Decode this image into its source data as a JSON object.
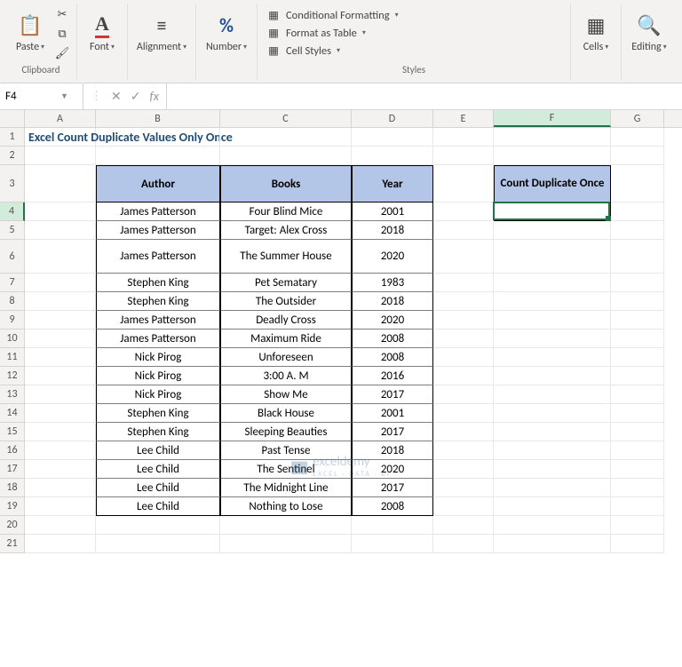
{
  "ribbon": {
    "clipboard": {
      "label": "Clipboard",
      "paste": "Paste"
    },
    "font": {
      "label": "Font"
    },
    "alignment": {
      "label": "Alignment"
    },
    "number": {
      "label": "Number"
    },
    "styles": {
      "label": "Styles",
      "conditional": "Conditional Formatting",
      "table": "Format as Table",
      "cellstyles": "Cell Styles"
    },
    "cells": {
      "label": "Cells"
    },
    "editing": {
      "label": "Editing"
    }
  },
  "formula_bar": {
    "name_box": "F4",
    "fx": "fx",
    "formula": ""
  },
  "columns": [
    "A",
    "B",
    "C",
    "D",
    "E",
    "F",
    "G"
  ],
  "active_cell": "F4",
  "title": "Excel Count Duplicate Values Only Once",
  "table": {
    "headers": {
      "author": "Author",
      "books": "Books",
      "year": "Year"
    },
    "rows": [
      {
        "author": "James Patterson",
        "book": "Four Blind Mice",
        "year": "2001"
      },
      {
        "author": "James Patterson",
        "book": "Target: Alex Cross",
        "year": "2018"
      },
      {
        "author": "James Patterson",
        "book": "The Summer House",
        "year": "2020"
      },
      {
        "author": "Stephen King",
        "book": "Pet Sematary",
        "year": "1983"
      },
      {
        "author": "Stephen King",
        "book": "The Outsider",
        "year": "2018"
      },
      {
        "author": "James Patterson",
        "book": "Deadly Cross",
        "year": "2020"
      },
      {
        "author": "James Patterson",
        "book": "Maximum Ride",
        "year": "2008"
      },
      {
        "author": "Nick Pirog",
        "book": "Unforeseen",
        "year": "2008"
      },
      {
        "author": "Nick Pirog",
        "book": "3:00 A. M",
        "year": "2016"
      },
      {
        "author": "Nick Pirog",
        "book": "Show Me",
        "year": "2017"
      },
      {
        "author": "Stephen King",
        "book": "Black House",
        "year": "2001"
      },
      {
        "author": "Stephen King",
        "book": "Sleeping Beauties",
        "year": "2017"
      },
      {
        "author": "Lee Child",
        "book": "Past Tense",
        "year": "2018"
      },
      {
        "author": "Lee Child",
        "book": "The Sentinel",
        "year": "2020"
      },
      {
        "author": "Lee Child",
        "book": "The Midnight Line",
        "year": "2017"
      },
      {
        "author": "Lee Child",
        "book": "Nothing to Lose",
        "year": "2008"
      }
    ]
  },
  "count_box": {
    "header": "Count Duplicate Once",
    "value": ""
  },
  "watermark": {
    "name": "exceldemy",
    "sub": "EXCEL · DATA · BI"
  }
}
